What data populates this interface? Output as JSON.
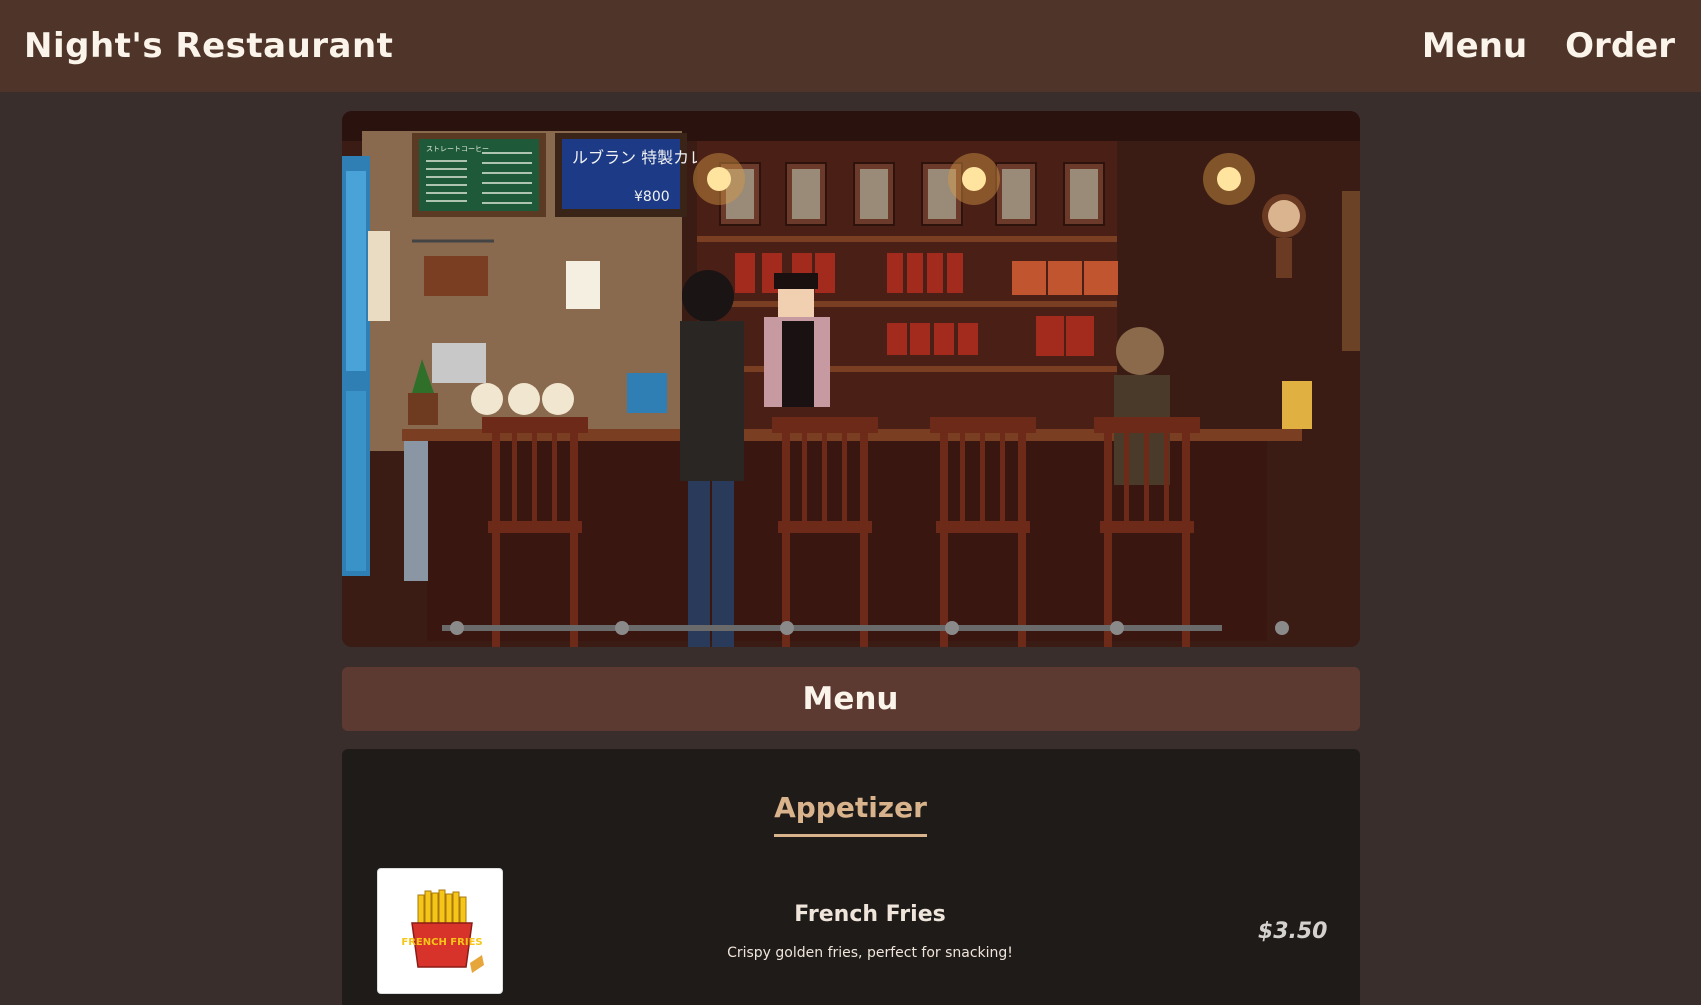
{
  "nav": {
    "brand": "Night's Restaurant",
    "links": [
      {
        "label": "Menu"
      },
      {
        "label": "Order"
      }
    ]
  },
  "hero": {
    "sign_menu_left": "ストレートコーヒー",
    "sign_curry": "ルブラン 特製カレー",
    "sign_price": "¥800"
  },
  "menu_section": {
    "title": "Menu"
  },
  "categories": [
    {
      "name": "Appetizer",
      "items": [
        {
          "name": "French Fries",
          "description": "Crispy golden fries, perfect for snacking!",
          "price": "$3.50",
          "image_text": "FRENCH FRIES"
        }
      ]
    }
  ],
  "colors": {
    "navbar": "#4f3429",
    "page_bg": "#3a2e2c",
    "section_bar": "#5d3a31",
    "panel_bg": "#1f1b19",
    "accent": "#d8b38b"
  }
}
